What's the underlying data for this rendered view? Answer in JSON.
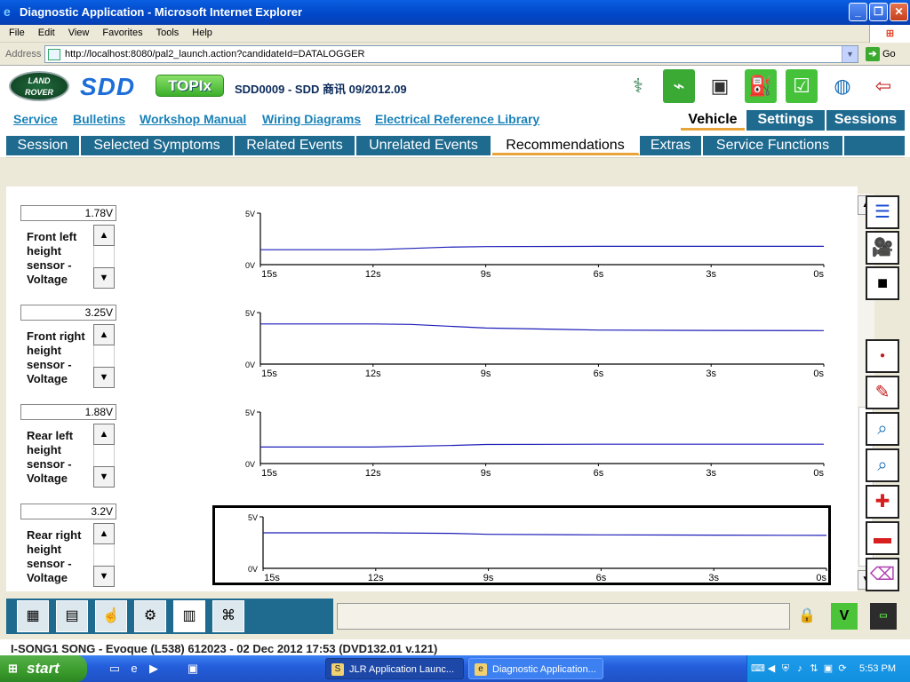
{
  "window": {
    "title": "Diagnostic Application - Microsoft Internet Explorer",
    "min": "_",
    "max": "❐",
    "close": "✕"
  },
  "menu": [
    "File",
    "Edit",
    "View",
    "Favorites",
    "Tools",
    "Help"
  ],
  "address": {
    "label": "Address",
    "url": "http://localhost:8080/pal2_launch.action?candidateId=DATALOGGER",
    "go": "Go"
  },
  "header": {
    "logo_line1": "LAND",
    "logo_line2": "ROVER",
    "sdd": "SDD",
    "topix": "TOPIx",
    "version": "SDD0009 - SDD 商讯 09/2012.09",
    "icons": [
      "stethoscope-icon",
      "plug-icon",
      "battery-icon",
      "fuel-can-icon",
      "wireless-check-icon",
      "globe-download-icon",
      "exit-door-icon"
    ]
  },
  "links": [
    "Service",
    "Bulletins",
    "Workshop Manual",
    "Wiring Diagrams",
    "Electrical Reference Library"
  ],
  "vehicle_tabs": [
    "Vehicle",
    "Settings",
    "Sessions"
  ],
  "tabs": [
    "Session",
    "Selected Symptoms",
    "Related Events",
    "Unrelated Events",
    "Recommendations",
    "Extras",
    "Service Functions"
  ],
  "active_tab": "Recommendations",
  "signals": [
    {
      "value": "1.78V",
      "name": "Front left height sensor - Voltage"
    },
    {
      "value": "3.25V",
      "name": "Front right height sensor - Voltage"
    },
    {
      "value": "1.88V",
      "name": "Rear left height sensor - Voltage"
    },
    {
      "value": "3.2V",
      "name": "Rear right height sensor - Voltage"
    }
  ],
  "spin": {
    "up": "▲",
    "down": "▼"
  },
  "chart_data": [
    {
      "type": "line",
      "y_unit": "V",
      "ylim": [
        0,
        5
      ],
      "y_ticks": [
        "5V",
        "0V"
      ],
      "x_ticks": [
        "15s",
        "12s",
        "9s",
        "6s",
        "3s",
        "0s"
      ],
      "x": [
        15,
        12,
        10,
        9,
        6,
        3,
        0
      ],
      "values": [
        1.45,
        1.45,
        1.7,
        1.75,
        1.78,
        1.78,
        1.78
      ],
      "color": "#1C1CB8"
    },
    {
      "type": "line",
      "y_unit": "V",
      "ylim": [
        0,
        5
      ],
      "y_ticks": [
        "5V",
        "0V"
      ],
      "x_ticks": [
        "15s",
        "12s",
        "9s",
        "6s",
        "3s",
        "0s"
      ],
      "x": [
        15,
        12,
        11,
        9,
        6,
        3,
        0
      ],
      "values": [
        3.9,
        3.9,
        3.85,
        3.5,
        3.3,
        3.27,
        3.25
      ],
      "color": "#1C1CB8"
    },
    {
      "type": "line",
      "y_unit": "V",
      "ylim": [
        0,
        5
      ],
      "y_ticks": [
        "5V",
        "0V"
      ],
      "x_ticks": [
        "15s",
        "12s",
        "9s",
        "6s",
        "3s",
        "0s"
      ],
      "x": [
        15,
        12,
        10,
        9,
        6,
        3,
        0
      ],
      "values": [
        1.6,
        1.6,
        1.75,
        1.85,
        1.88,
        1.88,
        1.88
      ],
      "color": "#1C1CB8"
    },
    {
      "type": "line",
      "y_unit": "V",
      "ylim": [
        0,
        5
      ],
      "y_ticks": [
        "5V",
        "0V"
      ],
      "x_ticks": [
        "15s",
        "12s",
        "9s",
        "6s",
        "3s",
        "0s"
      ],
      "x": [
        15,
        12,
        10,
        9,
        6,
        3,
        0
      ],
      "values": [
        3.45,
        3.45,
        3.4,
        3.3,
        3.25,
        3.22,
        3.2
      ],
      "color": "#1C1CB8"
    }
  ],
  "scrollbar": {
    "up": "▲",
    "down": "▼"
  },
  "right_tools": [
    "list-icon",
    "camera-icon",
    "stop-icon",
    "kph-record-icon",
    "notes-icon",
    "zoom-graph-icon",
    "zoom-graph-alt-icon",
    "kph-add-icon",
    "kph-remove-icon",
    "eraser-icon"
  ],
  "bottom_tools": [
    "data-table-icon",
    "kph-grid-icon",
    "touch-select-icon",
    "network-config-icon",
    "kph-list-icon",
    "vehicle-network-icon"
  ],
  "status_icons": [
    "lock-icon",
    "vehicle-voltage-icon",
    "battery-level-icon"
  ],
  "status_line": "I-SONG1 SONG - Evoque (L538) 612023 - 02 Dec 2012 17:53 (DVD132.01 v.121)",
  "taskbar": {
    "start": "start",
    "tasks": [
      "JLR Application Launc...",
      "Diagnostic Application..."
    ],
    "clock": "5:53 PM"
  }
}
